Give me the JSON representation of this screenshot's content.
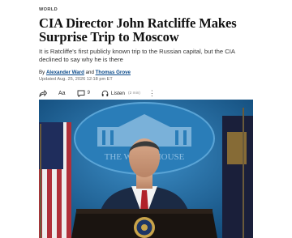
{
  "section": "WORLD",
  "headline": "CIA Director John Ratcliffe Makes Surprise Trip to Moscow",
  "dek": "It is Ratcliffe's first publicly known trip to the Russian capital, but the CIA declined to say why he is there",
  "byline": {
    "prefix": "By",
    "author1": "Alexander Ward",
    "conjunction": "and",
    "author2": "Thomas Grove"
  },
  "timestamp": "Updated Aug. 25, 2026 12:18 pm ET",
  "toolbar": {
    "share_icon": "share-icon",
    "text_size_icon": "text-size-icon",
    "text_size_label": "Aa",
    "comments_icon": "comment-icon",
    "comments_count": "9",
    "listen_icon": "headphones-icon",
    "listen_label": "Listen",
    "listen_duration": "(2 min)",
    "more_icon": "more-dots-icon",
    "more_label": "⋮"
  },
  "photo": {
    "podium_seal_text": "THE WHITE HOUSE",
    "backdrop_text": "THE WHITE HOUSE",
    "colors": {
      "backdrop": "#1f6fa8",
      "podium": "#1a1410",
      "suit": "#1b2a44",
      "tie": "#b0222a"
    }
  }
}
